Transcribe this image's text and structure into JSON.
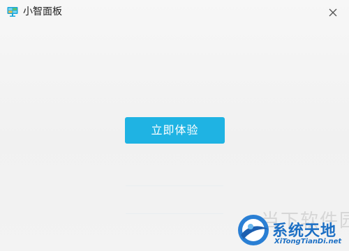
{
  "window": {
    "title": "小智面板",
    "icon": "monitor-icon",
    "close_icon": "close-icon"
  },
  "main": {
    "action_button_label": "立即体验"
  },
  "watermark": {
    "ghost_text": "当下软件园",
    "brand_text": "系统天地",
    "url": "XiTongTianDi.net"
  },
  "colors": {
    "accent": "#1fb3e3",
    "watermark_blue": "#1c6fc4"
  }
}
